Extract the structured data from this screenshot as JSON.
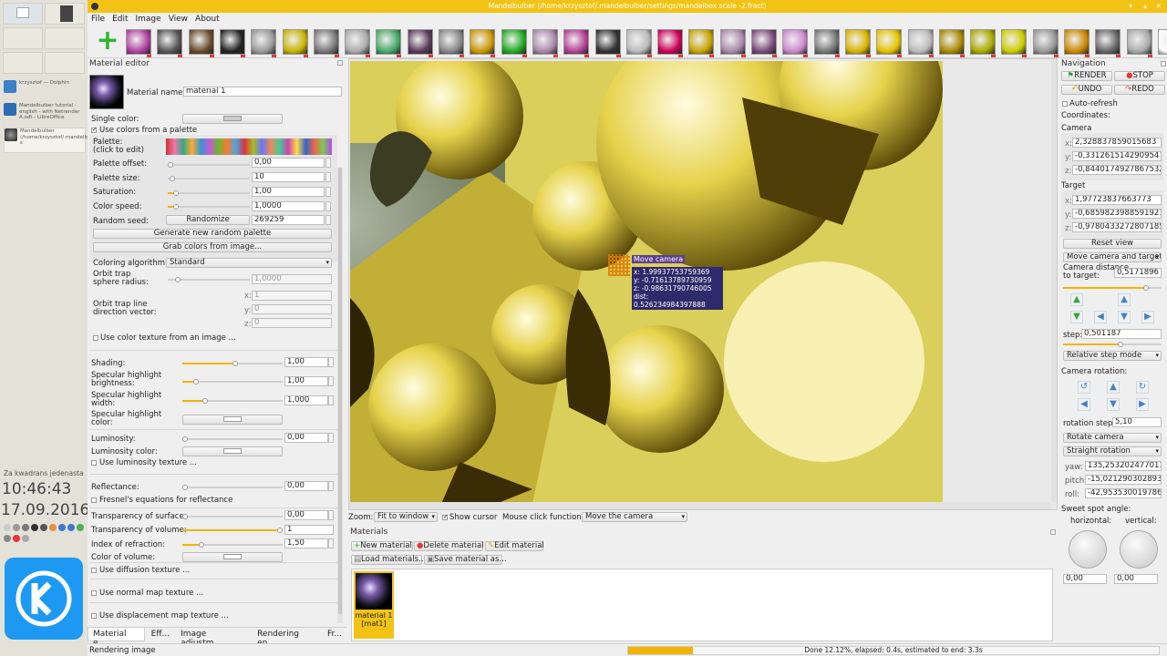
{
  "window": {
    "title": "Mandelbulber (/home/krzysztof/.mandelbulber/settings/mandelbox scale -2.fract)"
  },
  "menu": [
    "File",
    "Edit",
    "Image",
    "View",
    "About"
  ],
  "kde": {
    "tasks": [
      {
        "title": "krzysztof — Dolphin"
      },
      {
        "title": "Mandelbulber tutorial - english - with Netrender A.odt - LibreOffice"
      },
      {
        "title": "Mandelbulber (/home/krzysztof/.mandelbulber/settings/mandelbox s"
      }
    ],
    "clock_label": "Za kwadrans jedenasta",
    "time": "10:46:43",
    "date": "17.09.2016"
  },
  "material_editor": {
    "header": "Material editor",
    "material_name_label": "Material name:",
    "material_name": "material 1",
    "single_color_label": "Single color:",
    "use_palette_label": "Use colors from a palette",
    "palette_label": "Palette:\n(click to edit)",
    "palette_offset_label": "Palette offset:",
    "palette_offset": "0,00",
    "palette_size_label": "Palette size:",
    "palette_size": "10",
    "saturation_label": "Saturation:",
    "saturation": "1,00",
    "color_speed_label": "Color speed:",
    "color_speed": "1,0000",
    "random_seed_label": "Random seed:",
    "randomize_label": "Randomize",
    "random_seed": "269259",
    "generate_palette_label": "Generate new random palette",
    "grab_colors_label": "Grab colors from image...",
    "coloring_algorithm_label": "Coloring algorithm:",
    "coloring_algorithm": "Standard",
    "orbit_trap_radius_label": "Orbit trap\nsphere radius:",
    "orbit_trap_radius": "1,0000",
    "orbit_trap_line_label": "Orbit trap line\ndirection vector:",
    "orbit_x": "1",
    "orbit_y": "0",
    "orbit_z": "0",
    "use_color_texture_label": "Use color texture from an image ...",
    "shading_label": "Shading:",
    "shading": "1,00",
    "spec_brightness_label": "Specular highlight\nbrightness:",
    "spec_brightness": "1,00",
    "spec_width_label": "Specular highlight\nwidth:",
    "spec_width": "1,000",
    "spec_color_label": "Specular highlight\ncolor:",
    "luminosity_label": "Luminosity:",
    "luminosity": "0,00",
    "luminosity_color_label": "Luminosity color:",
    "use_luminosity_texture_label": "Use luminosity texture ...",
    "reflectance_label": "Reflectance:",
    "reflectance": "0,00",
    "fresnel_label": "Fresnel's equations for reflectance",
    "transparency_surface_label": "Transparency of surface:",
    "transparency_surface": "0,00",
    "transparency_volume_label": "Transparency of volume:",
    "transparency_volume": "1",
    "ior_label": "Index of refraction:",
    "ior": "1,50",
    "color_volume_label": "Color of volume:",
    "use_diffusion_label": "Use diffusion texture ...",
    "use_normal_label": "Use normal map texture ...",
    "use_displacement_label": "Use displacement map texture ...",
    "tabs": [
      "Material e...",
      "Eff...",
      "Image adjustm...",
      "Rendering en...",
      "Fr..."
    ]
  },
  "render": {
    "tooltip_title": "Move camera",
    "tooltip_x": "x: 1.99937753759369",
    "tooltip_y": "y: -0.71613789730959",
    "tooltip_z": "z: -0.98631790746005",
    "tooltip_dist": "dist: 0.526234984397888"
  },
  "zoombar": {
    "zoom_label": "Zoom:",
    "zoom_value": "Fit to window",
    "show_cursor_label": "Show cursor",
    "mouse_click_label": "Mouse click function:",
    "mouse_click_value": "Move the camera"
  },
  "materials": {
    "header": "Materials",
    "new_label": "New material",
    "delete_label": "Delete material",
    "edit_label": "Edit material",
    "load_label": "Load materials...",
    "save_label": "Save material as...",
    "item_label": "material 1\n[mat1]"
  },
  "navigation": {
    "header": "Navigation",
    "render_label": "RENDER",
    "stop_label": "STOP",
    "undo_label": "UNDO",
    "redo_label": "REDO",
    "auto_refresh_label": "Auto-refresh",
    "coordinates_label": "Coordinates:",
    "camera_label": "Camera",
    "camera_x": "2,328837859015683",
    "camera_y": "-0,3312615142909547",
    "camera_z": "-0,8440174927867532",
    "target_label": "Target",
    "target_x": "1,97723837663773",
    "target_y": "-0,6859823988591921",
    "target_z": "-0,9780433272807185",
    "reset_view_label": "Reset view",
    "move_mode": "Move camera and target",
    "camera_distance_label": "Camera distance\nto target:",
    "camera_distance": "0,5171896",
    "step_label": "step:",
    "step": "0,501187",
    "step_mode": "Relative step mode",
    "camera_rotation_label": "Camera rotation:",
    "rotation_step_label": "rotation step:",
    "rotation_step": "5,10",
    "rotate_mode": "Rotate camera",
    "straight_mode": "Straight rotation",
    "yaw_label": "yaw:",
    "yaw": "135,253202477011",
    "pitch_label": "pitch:",
    "pitch": "-15,02129030289378",
    "roll_label": "roll:",
    "roll": "-42,95353001978629",
    "sweet_spot_label": "Sweet spot angle:",
    "horizontal_label": "horizontal:",
    "vertical_label": "vertical:",
    "horizontal": "0,00",
    "vertical": "0,00"
  },
  "status": {
    "left": "Rendering image",
    "progress_text": "Done 12.12%, elapsed: 0.4s, estimated to end: 3.3s",
    "progress_fraction": 0.1212
  },
  "colors": {
    "accent": "#f2c314",
    "progress": "#f0b400"
  }
}
